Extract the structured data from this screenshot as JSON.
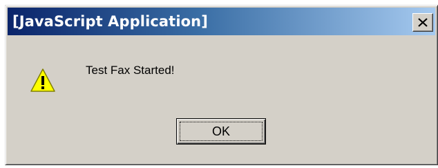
{
  "window": {
    "title": "[JavaScript Application]",
    "close_symbol": "X"
  },
  "message": {
    "text": "Test Fax Started!",
    "icon": "warning-icon"
  },
  "buttons": {
    "ok_label": "OK"
  },
  "colors": {
    "title_bar_start": "#0a246a",
    "title_bar_end": "#a6caf0",
    "dialog_face": "#d4d0c8",
    "warning_yellow": "#ffff00"
  }
}
